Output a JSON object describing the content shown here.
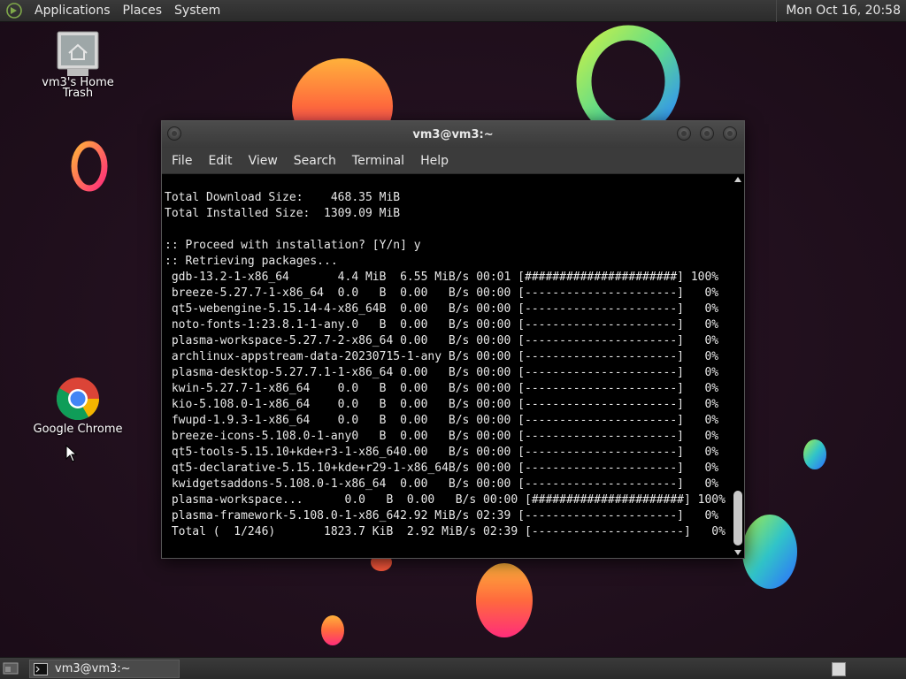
{
  "top_panel": {
    "menus": [
      "Applications",
      "Places",
      "System"
    ],
    "clock": "Mon Oct 16, 20:58",
    "logo_icon": "mate-logo-icon"
  },
  "desktop": {
    "icons": [
      {
        "label_a": "vm3's Home",
        "label_b": "Trash",
        "icon": "trash-icon"
      },
      {
        "label": "Google Chrome",
        "icon": "chrome-icon"
      }
    ],
    "wallpaper_colors": {
      "background": "#1f0f1c",
      "orange": "#ff6a3d",
      "yellow": "#ffb13b",
      "pink": "#ff2d7a",
      "green": "#8bea4f",
      "blue": "#2d8cff"
    }
  },
  "terminal": {
    "title": "vm3@vm3:~",
    "menu": [
      "File",
      "Edit",
      "View",
      "Search",
      "Terminal",
      "Help"
    ],
    "lines": [
      "Total Download Size:    468.35 MiB",
      "Total Installed Size:  1309.09 MiB",
      "",
      ":: Proceed with installation? [Y/n] y",
      ":: Retrieving packages...",
      " gdb-13.2-1-x86_64       4.4 MiB  6.55 MiB/s 00:01 [######################] 100%",
      " breeze-5.27.7-1-x86_64  0.0   B  0.00   B/s 00:00 [----------------------]   0%",
      " qt5-webengine-5.15.14-4-x86_64B  0.00   B/s 00:00 [----------------------]   0%",
      " noto-fonts-1:23.8.1-1-any.0   B  0.00   B/s 00:00 [----------------------]   0%",
      " plasma-workspace-5.27.7-2-x86_64 0.00   B/s 00:00 [----------------------]   0%",
      " archlinux-appstream-data-20230715-1-any B/s 00:00 [----------------------]   0%",
      " plasma-desktop-5.27.7.1-1-x86_64 0.00   B/s 00:00 [----------------------]   0%",
      " kwin-5.27.7-1-x86_64    0.0   B  0.00   B/s 00:00 [----------------------]   0%",
      " kio-5.108.0-1-x86_64    0.0   B  0.00   B/s 00:00 [----------------------]   0%",
      " fwupd-1.9.3-1-x86_64    0.0   B  0.00   B/s 00:00 [----------------------]   0%",
      " breeze-icons-5.108.0-1-any0   B  0.00   B/s 00:00 [----------------------]   0%",
      " qt5-tools-5.15.10+kde+r3-1-x86_640.00   B/s 00:00 [----------------------]   0%",
      " qt5-declarative-5.15.10+kde+r29-1-x86_64B/s 00:00 [----------------------]   0%",
      " kwidgetsaddons-5.108.0-1-x86_64  0.00   B/s 00:00 [----------------------]   0%",
      " plasma-workspace...      0.0   B  0.00   B/s 00:00 [######################] 100%",
      " plasma-framework-5.108.0-1-x86_642.92 MiB/s 02:39 [----------------------]   0%",
      " Total (  1/246)       1823.7 KiB  2.92 MiB/s 02:39 [----------------------]   0%"
    ]
  },
  "bottom_panel": {
    "task_label": "vm3@vm3:~"
  }
}
